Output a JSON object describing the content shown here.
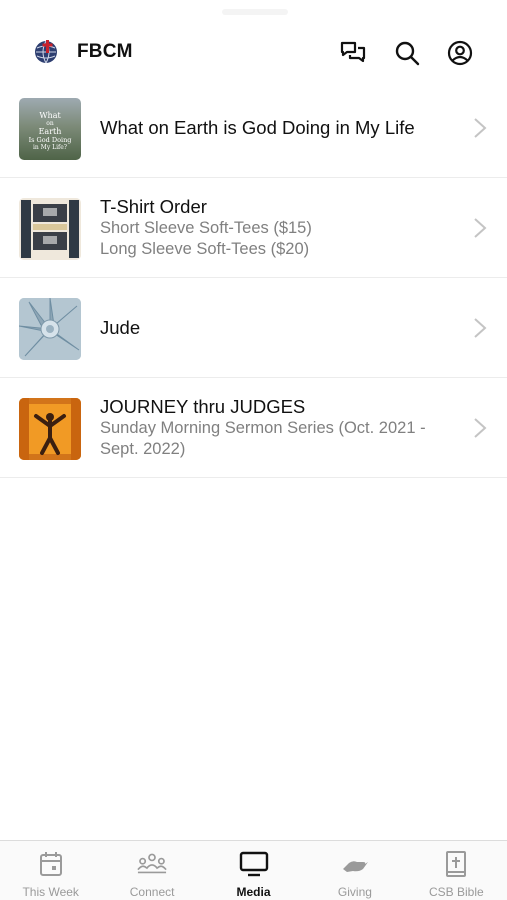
{
  "app": {
    "title": "FBCM"
  },
  "items": [
    {
      "title": "What on Earth is God Doing in My Life",
      "subtitle": "",
      "thumb_text": [
        "What",
        "on",
        "Earth",
        "Is God Doing",
        "in My Life?"
      ]
    },
    {
      "title": "T-Shirt Order",
      "subtitle": "Short Sleeve Soft-Tees ($15)\nLong Sleeve Soft-Tees ($20)"
    },
    {
      "title": "Jude",
      "subtitle": ""
    },
    {
      "title": "JOURNEY thru JUDGES",
      "subtitle": "Sunday Morning Sermon Series (Oct. 2021 - Sept. 2022)"
    }
  ],
  "tabs": [
    {
      "label": "This Week",
      "icon": "calendar-icon"
    },
    {
      "label": "Connect",
      "icon": "people-icon"
    },
    {
      "label": "Media",
      "icon": "tv-icon",
      "active": true
    },
    {
      "label": "Giving",
      "icon": "hand-icon"
    },
    {
      "label": "CSB Bible",
      "icon": "bible-icon"
    }
  ],
  "colors": {
    "accent": "#111111",
    "inactive": "#9a9a9a",
    "divider": "#ececec"
  }
}
